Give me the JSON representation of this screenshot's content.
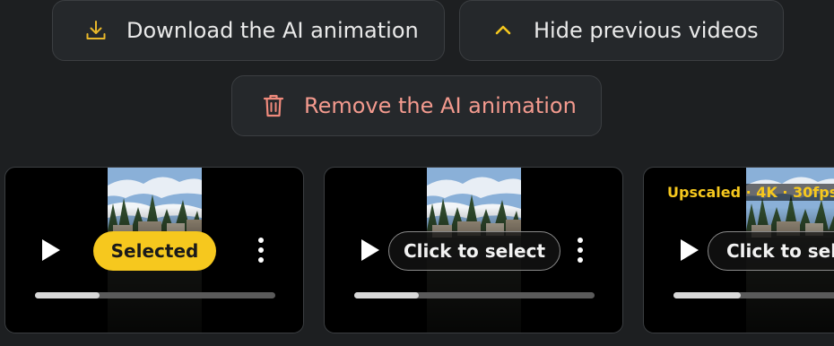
{
  "actions": {
    "download_label": "Download the AI animation",
    "hide_label": "Hide previous videos",
    "remove_label": "Remove the AI animation"
  },
  "icons": {
    "download": "download-icon",
    "hide": "chevron-up-icon",
    "remove": "trash-icon",
    "play": "play-icon",
    "more": "more-vertical-icon"
  },
  "colors": {
    "accent": "#f6c81e",
    "danger": "#f39a8e",
    "background": "#1d1f21",
    "button_bg": "#25282b"
  },
  "videos": [
    {
      "status_label": "Selected",
      "selected": true,
      "progress": 0.27
    },
    {
      "status_label": "Click to select",
      "selected": false,
      "progress": 0.27
    },
    {
      "status_label": "Click to select",
      "selected": false,
      "progress": 0.28,
      "badge": "Upscaled · 4K · 30fps"
    }
  ]
}
